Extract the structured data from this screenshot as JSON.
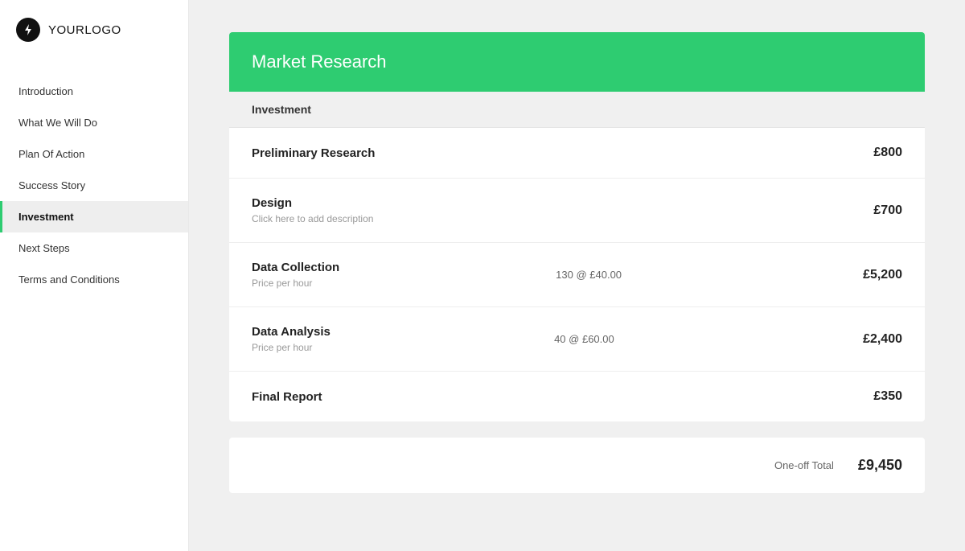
{
  "logo": {
    "icon_label": "lightning-bolt-icon",
    "text_bold": "YOUR",
    "text_regular": "LOGO"
  },
  "sidebar": {
    "items": [
      {
        "id": "introduction",
        "label": "Introduction",
        "active": false
      },
      {
        "id": "what-we-will-do",
        "label": "What We Will Do",
        "active": false
      },
      {
        "id": "plan-of-action",
        "label": "Plan Of Action",
        "active": false
      },
      {
        "id": "success-story",
        "label": "Success Story",
        "active": false
      },
      {
        "id": "investment",
        "label": "Investment",
        "active": true
      },
      {
        "id": "next-steps",
        "label": "Next Steps",
        "active": false
      },
      {
        "id": "terms-and-conditions",
        "label": "Terms and Conditions",
        "active": false
      }
    ]
  },
  "main": {
    "card_title": "Market Research",
    "investment_section_label": "Investment",
    "line_items": [
      {
        "name": "Preliminary Research",
        "sub": "",
        "middle": "",
        "price": "£800"
      },
      {
        "name": "Design",
        "sub": "Click here to add description",
        "middle": "",
        "price": "£700"
      },
      {
        "name": "Data Collection",
        "sub": "Price per hour",
        "middle": "130 @ £40.00",
        "price": "£5,200"
      },
      {
        "name": "Data Analysis",
        "sub": "Price per hour",
        "middle": "40 @ £60.00",
        "price": "£2,400"
      },
      {
        "name": "Final Report",
        "sub": "",
        "middle": "",
        "price": "£350"
      }
    ],
    "total_label": "One-off Total",
    "total_value": "£9,450"
  }
}
